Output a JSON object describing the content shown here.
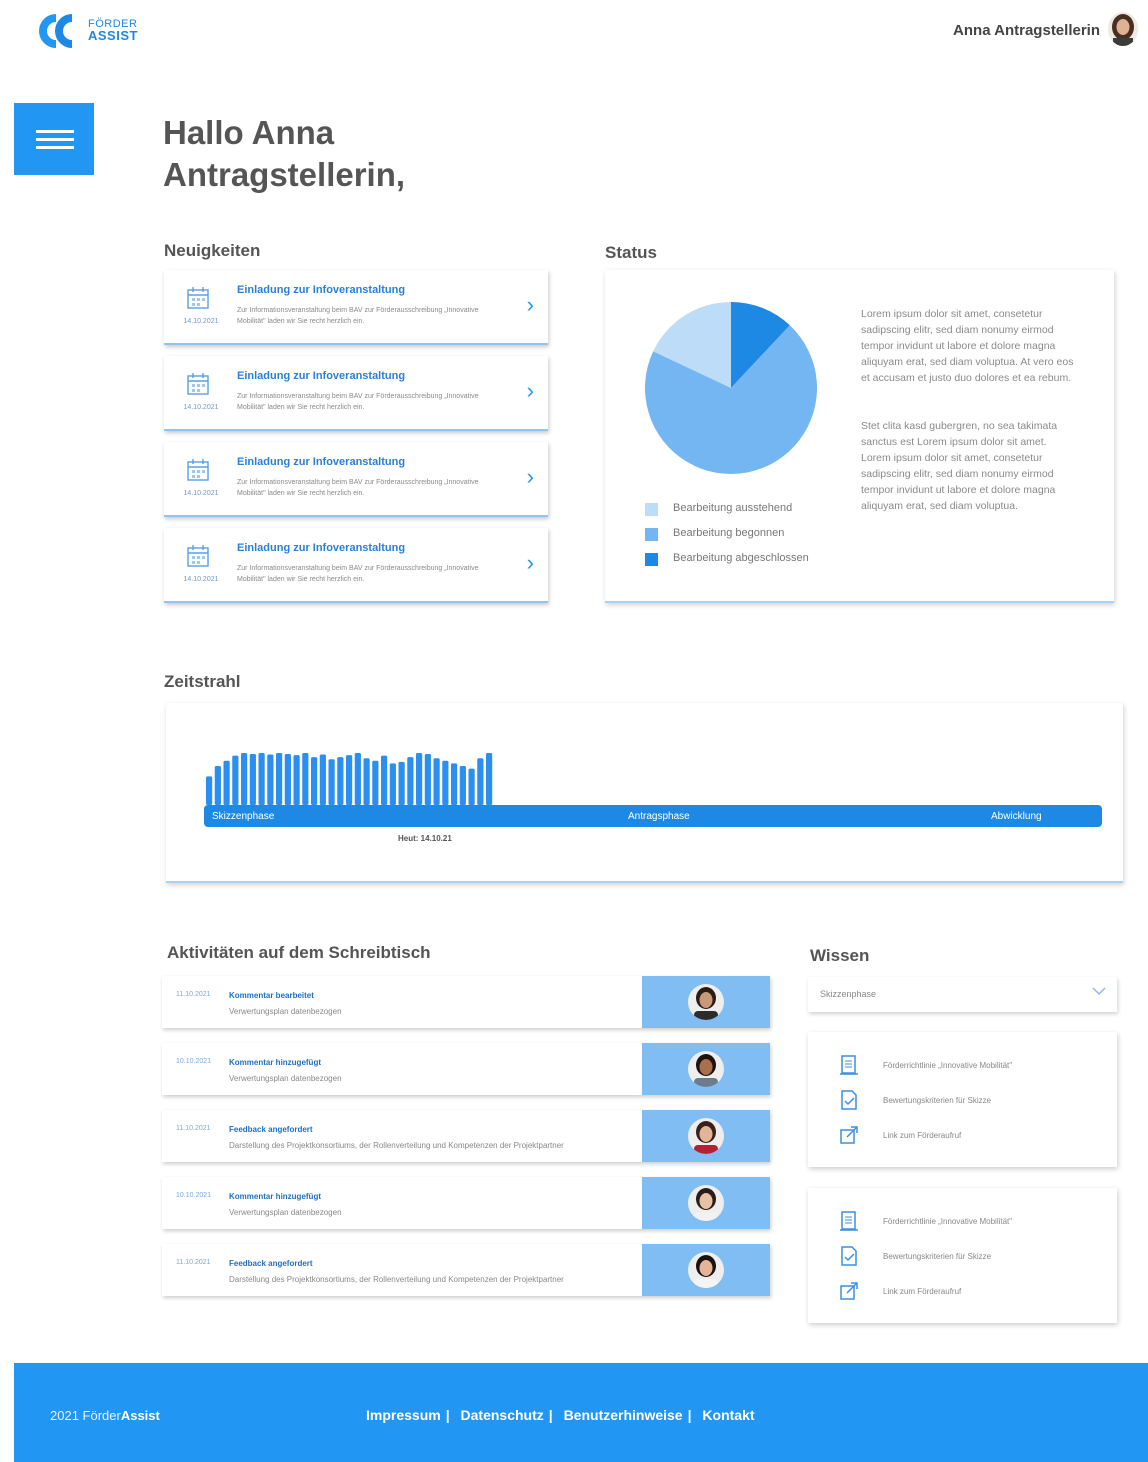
{
  "header": {
    "logo_line1": "FÖRDER",
    "logo_line2": "ASSIST",
    "user_name": "Anna Antragstellerin"
  },
  "greeting": "Hallo Anna Antragstellerin,",
  "news": {
    "title": "Neuigkeiten",
    "items": [
      {
        "title": "Einladung zur Infoveranstaltung",
        "desc": "Zur Informationsveranstaltung beim BAV zur Förderausschreibung „Innovative Mobilität\" laden wir Sie recht herzlich ein.",
        "date": "14.10.2021"
      },
      {
        "title": "Einladung zur Infoveranstaltung",
        "desc": "Zur Informationsveranstaltung beim BAV zur Förderausschreibung „Innovative Mobilität\" laden wir Sie recht herzlich ein.",
        "date": "14.10.2021"
      },
      {
        "title": "Einladung zur Infoveranstaltung",
        "desc": "Zur Informationsveranstaltung beim BAV zur Förderausschreibung „Innovative Mobilität\" laden wir Sie recht herzlich ein.",
        "date": "14.10.2021"
      },
      {
        "title": "Einladung zur Infoveranstaltung",
        "desc": "Zur Informationsveranstaltung beim BAV zur Förderausschreibung „Innovative Mobilität\" laden wir Sie recht herzlich ein.",
        "date": "14.10.2021"
      }
    ]
  },
  "status": {
    "title": "Status",
    "legend": [
      {
        "label": "Bearbeitung ausstehend",
        "color": "#bcdcf8"
      },
      {
        "label": "Bearbeitung begonnen",
        "color": "#74b6f2"
      },
      {
        "label": "Bearbeitung abgeschlossen",
        "color": "#1e88e5"
      }
    ],
    "text1": "Lorem ipsum dolor sit amet, consetetur sadipscing elitr, sed diam nonumy eirmod tempor invidunt ut labore et dolore magna aliquyam erat, sed diam voluptua. At vero eos et accusam et justo duo dolores et ea rebum.",
    "text2": "Stet clita kasd gubergren, no sea takimata sanctus est Lorem ipsum dolor sit amet. Lorem ipsum dolor sit amet, consetetur sadipscing elitr, sed diam nonumy eirmod tempor invidunt ut labore et dolore magna aliquyam erat, sed diam voluptua."
  },
  "chart_data": {
    "type": "pie",
    "categories": [
      "Bearbeitung ausstehend",
      "Bearbeitung begonnen",
      "Bearbeitung abgeschlossen"
    ],
    "values": [
      18,
      70,
      12
    ],
    "colors": [
      "#bcdcf8",
      "#74b6f2",
      "#1e88e5"
    ]
  },
  "timeline": {
    "title": "Zeitstrahl",
    "phases": [
      "Skizzenphase",
      "Antragsphase",
      "Abwicklung"
    ],
    "today": "Heut: 14.10.21",
    "activity_bars": [
      0.55,
      0.75,
      0.85,
      0.95,
      1.0,
      0.98,
      1.0,
      0.97,
      1.0,
      0.98,
      0.96,
      1.0,
      0.92,
      0.97,
      0.88,
      0.92,
      0.96,
      1.0,
      0.9,
      0.85,
      0.95,
      0.8,
      0.83,
      0.92,
      1.0,
      0.98,
      0.9,
      0.85,
      0.8,
      0.75,
      0.7,
      0.9,
      1.0
    ]
  },
  "activities": {
    "title": "Aktivitäten auf dem Schreibtisch",
    "items": [
      {
        "date": "11.10.2021",
        "title": "Kommentar bearbeitet",
        "desc": "Verwertungsplan datenbezogen",
        "skin": "#c99a7a",
        "hair": "#2b1d14",
        "shirt": "#2c2c2c"
      },
      {
        "date": "10.10.2021",
        "title": "Kommentar hinzugefügt",
        "desc": "Verwertungsplan datenbezogen",
        "skin": "#a8704e",
        "hair": "#1d1410",
        "shirt": "#6b7d8c"
      },
      {
        "date": "11.10.2021",
        "title": "Feedback angefordert",
        "desc": "Darstellung des Projektkonsortiums, der Rollenverteilung und Kompetenzen der Projektpartner",
        "skin": "#e2b59a",
        "hair": "#3a2218",
        "shirt": "#b22234"
      },
      {
        "date": "10.10.2021",
        "title": "Kommentar hinzugefügt",
        "desc": "Verwertungsplan datenbezogen",
        "skin": "#e9c2a6",
        "hair": "#2a1c16",
        "shirt": "#f2f2f2"
      },
      {
        "date": "11.10.2021",
        "title": "Feedback angefordert",
        "desc": "Darstellung des Projektkonsortiums, der Rollenverteilung und Kompetenzen der Projektpartner",
        "skin": "#e4b49a",
        "hair": "#1a1210",
        "shirt": "#f4f4f4"
      }
    ]
  },
  "knowledge": {
    "title": "Wissen",
    "dropdown_value": "Skizzenphase",
    "cards": [
      {
        "items": [
          {
            "label": "Förderrichtlinie „Innovative Mobilität\"",
            "icon": "document-icon"
          },
          {
            "label": "Bewertungskriterien für Skizze",
            "icon": "checklist-icon"
          },
          {
            "label": "Link zum Förderaufruf",
            "icon": "external-link-icon"
          }
        ]
      },
      {
        "items": [
          {
            "label": "Förderrichtlinie „Innovative Mobilität\"",
            "icon": "document-icon"
          },
          {
            "label": "Bewertungskriterien für Skizze",
            "icon": "checklist-icon"
          },
          {
            "label": "Link zum Förderaufruf",
            "icon": "external-link-icon"
          }
        ]
      }
    ]
  },
  "footer": {
    "copyright_prefix": "2021 Förder",
    "copyright_brand": "Assist",
    "links": [
      "Impressum",
      "Datenschutz",
      "Benutzerhinweise",
      "Kontakt"
    ]
  }
}
